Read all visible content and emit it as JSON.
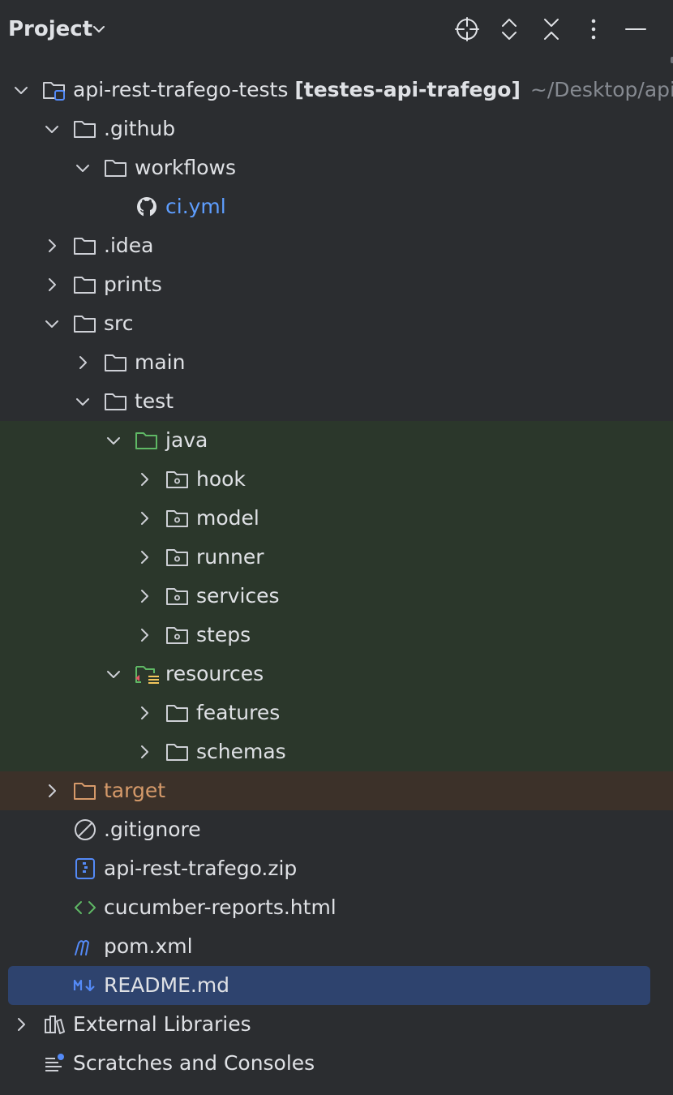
{
  "header": {
    "title": "Project",
    "actions": [
      "locate-icon",
      "expand-collapse-icon",
      "collapse-all-icon",
      "more-options-icon",
      "hide-panel-icon"
    ]
  },
  "tree": {
    "root": {
      "name": "api-rest-trafego-tests",
      "module": "[testes-api-trafego]",
      "path": "~/Desktop/api-r"
    },
    "github": ".github",
    "workflows": "workflows",
    "ci": "ci.yml",
    "idea": ".idea",
    "prints": "prints",
    "src": "src",
    "main": "main",
    "test": "test",
    "java": "java",
    "hook": "hook",
    "model": "model",
    "runner": "runner",
    "services": "services",
    "steps": "steps",
    "resources": "resources",
    "features": "features",
    "schemas": "schemas",
    "target": "target",
    "gitignore": ".gitignore",
    "zip": "api-rest-trafego.zip",
    "cucumber": "cucumber-reports.html",
    "pom": "pom.xml",
    "readme": "README.md",
    "external_libraries": "External Libraries",
    "scratches": "Scratches and Consoles"
  },
  "colors": {
    "background": "#2b2d30",
    "text": "#dfe1e5",
    "link": "#5e9eff",
    "excluded": "#d69a6a",
    "sources_band": "#2b372b",
    "excluded_band": "#3c3129",
    "selection": "#2e436e"
  }
}
